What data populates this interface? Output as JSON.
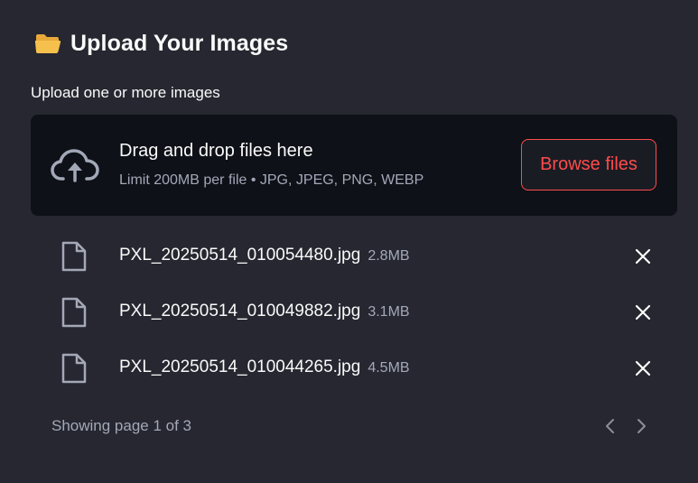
{
  "uploader": {
    "icon": "open-folder-icon",
    "heading": "Upload Your Images",
    "label": "Upload one or more images",
    "dropzone": {
      "icon": "cloud-upload-icon",
      "main_text": "Drag and drop files here",
      "sub_text": "Limit 200MB per file • JPG, JPEG, PNG, WEBP",
      "browse_label": "Browse files"
    },
    "files": [
      {
        "name": "PXL_20250514_010054480.jpg",
        "size": "2.8MB"
      },
      {
        "name": "PXL_20250514_010049882.jpg",
        "size": "3.1MB"
      },
      {
        "name": "PXL_20250514_010044265.jpg",
        "size": "4.5MB"
      }
    ],
    "pagination": {
      "text": "Showing page 1 of 3",
      "prev_icon": "chevron-left-icon",
      "next_icon": "chevron-right-icon"
    }
  },
  "colors": {
    "background": "#262730",
    "dropzone_bg": "#0e1117",
    "accent": "#ff4b4b",
    "muted_text": "#a3a8b8",
    "folder": "#f6c04d"
  }
}
